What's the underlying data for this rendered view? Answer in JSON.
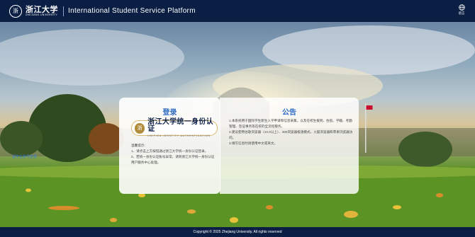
{
  "header": {
    "logo_cn": "浙江大学",
    "logo_en": "ZHEJIANG UNIVERSITY",
    "platform_title": "International Student Service Platform",
    "language_label": "语言"
  },
  "login": {
    "title": "登录",
    "badge_cn": "浙江大学统一身份认证",
    "badge_en": "UNIFIED IDENTITY AUTHENTICATION",
    "tips": [
      "温馨提示：",
      "1、请点击上方按钮通过浙江大学统一身份认证登录。",
      "2、若统一身份认证账号异常，请到浙江大学统一身份认证用户服务中心处理。"
    ],
    "link_label": "留学生账号登录"
  },
  "notice": {
    "title": "公告",
    "items": [
      "1.本系统用于国际学生新生入学申请和信息采集，以及在校生报到、住宿、学籍、考勤管理、签证事务等在校的全流程服务。",
      "2.建议使用谷歌浏览器（10.0以上）、360浏览器极速模式，火狐浏览器和苹果浏览器访问。",
      "3.填写信息时请使用中文或英文。"
    ]
  },
  "footer": {
    "copyright": "Copyright © 2025 Zhejiang University. All rights reserved"
  },
  "colors": {
    "header_bg": "#0b1f45",
    "accent": "#2f6bc4",
    "link": "#3a7bd5"
  }
}
